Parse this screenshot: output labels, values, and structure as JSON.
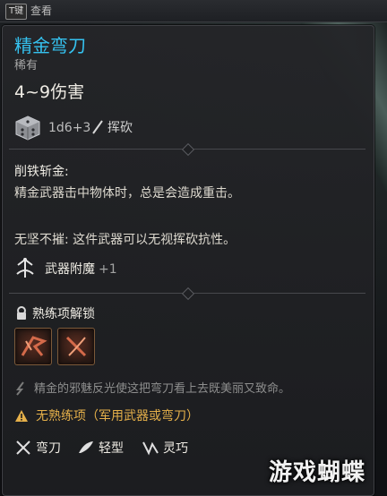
{
  "topbar": {
    "key": "T键",
    "view": "查看"
  },
  "item": {
    "name": "精金弯刀",
    "rarity": "稀有",
    "damage": "4~9伤害",
    "dice": "1d6+3",
    "damage_type": "挥砍",
    "name_color": "#35c2f0"
  },
  "ability": {
    "title": "削铁斩金:",
    "text": "精金武器击中物体时，总是会造成重击。",
    "unbreakable": "无坚不摧: 这件武器可以无视挥砍抗性。"
  },
  "enchant": {
    "label": "武器附魔",
    "bonus": "+1"
  },
  "proficiency": {
    "title": "熟练项解锁",
    "slots": [
      "slash-skill-icon",
      "parry-skill-icon"
    ]
  },
  "flavor": "精金的邪魅反光使这把弯刀看上去既美丽又致命。",
  "warning": {
    "text": "无熟练项（军用武器或弯刀）",
    "color": "#e5b04a"
  },
  "tags": [
    {
      "label": "弯刀",
      "icon": "crossed-blades-icon"
    },
    {
      "label": "轻型",
      "icon": "feather-icon"
    },
    {
      "label": "灵巧",
      "icon": "finesse-icon"
    }
  ],
  "watermark": "游戏蝴蝶"
}
